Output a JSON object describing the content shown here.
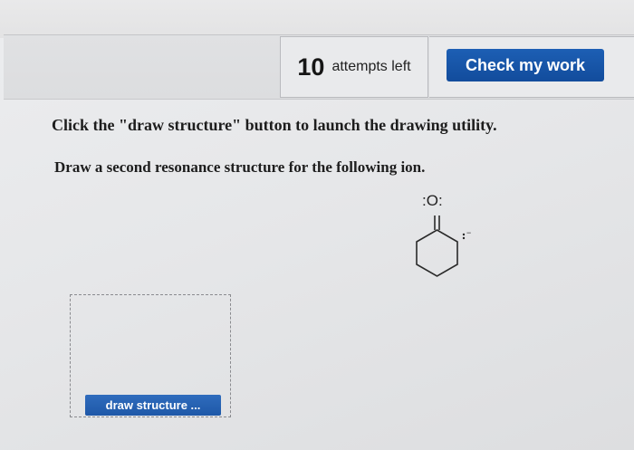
{
  "header": {
    "attempts_number": "10",
    "attempts_text": "attempts left",
    "check_label": "Check my work"
  },
  "content": {
    "instruction": "Click the \"draw structure\" button to launch the drawing utility.",
    "question": "Draw a second resonance structure for the following ion.",
    "oxygen_label": ":O:"
  },
  "draw_area": {
    "button_label": "draw structure ..."
  },
  "colors": {
    "accent": "#1a55a6",
    "button_text": "#ffffff"
  }
}
